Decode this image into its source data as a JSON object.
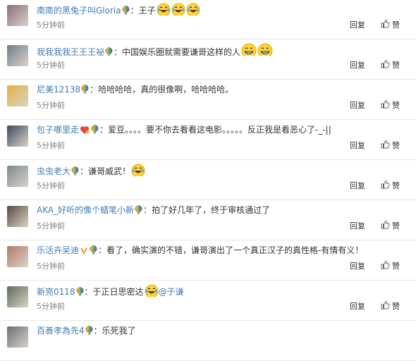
{
  "comments": [
    {
      "user": "南南的黑兔子叫Gloria",
      "badges": [
        "rainbow"
      ],
      "prefix": "",
      "text": "：王子",
      "emojis": [
        "laugh-cry",
        "laugh-cry",
        "laugh-cry"
      ],
      "mention": "",
      "time": "5分钟前",
      "reply": "回复",
      "like": "赞",
      "avatar_color": "#8a6d7a"
    },
    {
      "user": "我我我我王王王祕",
      "badges": [
        "rainbow"
      ],
      "prefix": "",
      "text": "：中国娱乐圈就需要谦哥这样的人",
      "emojis": [
        "grin",
        "grin"
      ],
      "mention": "",
      "time": "5分钟前",
      "reply": "回复",
      "like": "赞",
      "avatar_color": "#6f7d8a"
    },
    {
      "user": "尼美12138",
      "badges": [
        "rainbow"
      ],
      "prefix": "",
      "text": "：哈哈哈哈，真的很像啊，哈哈哈哈。",
      "emojis": [],
      "mention": "",
      "time": "5分钟前",
      "reply": "回复",
      "like": "赞",
      "avatar_color": "#e3b23c"
    },
    {
      "user": "包子哪里走",
      "badges": [
        "heart",
        "rainbow"
      ],
      "prefix": "",
      "text": "：爱豆。。。。要不你去看看这电影。。。。。反正我是看恶心了-_-||",
      "emojis": [],
      "mention": "",
      "time": "5分钟前",
      "reply": "回复",
      "like": "赞",
      "avatar_color": "#3b4a5c"
    },
    {
      "user": "虫虫老大",
      "badges": [
        "rainbow"
      ],
      "prefix": "",
      "text": "：谦哥威武！",
      "emojis": [
        "laugh-cry"
      ],
      "mention": "",
      "time": "5分钟前",
      "reply": "回复",
      "like": "赞",
      "avatar_color": "#7c8a8f"
    },
    {
      "user": "AKA_好听的像个蜡笔小新",
      "badges": [
        "rainbow"
      ],
      "prefix": "",
      "text": "：拍了好几年了，终于审核通过了",
      "emojis": [],
      "mention": "",
      "time": "5分钟前",
      "reply": "回复",
      "like": "赞",
      "avatar_color": "#5a4a3e"
    },
    {
      "user": "乐活卉吴迪",
      "badges": [
        "vip",
        "rainbow"
      ],
      "prefix": "",
      "text": "：看了，确实演的不错，谦哥演出了一个真正汉子的真性格-有情有义！",
      "emojis": [],
      "mention": "",
      "time": "5分钟前",
      "reply": "回复",
      "like": "赞",
      "avatar_color": "#b47b6a"
    },
    {
      "user": "新亮0118",
      "badges": [
        "rainbow"
      ],
      "prefix": "",
      "text": "：于正日思密达",
      "emojis": [
        "laugh-cry"
      ],
      "mention": "@于谦",
      "time": "5分钟前",
      "reply": "回复",
      "like": "赞",
      "avatar_color": "#5d6b55"
    },
    {
      "user": "百善孝為先4",
      "badges": [
        "rainbow"
      ],
      "prefix": "",
      "text": "：乐死我了",
      "emojis": [],
      "mention": "",
      "time": "",
      "reply": "",
      "like": "",
      "avatar_color": "#6d6d75"
    }
  ],
  "colors": {
    "username": "#3f7cb6",
    "divider": "#e6e6e6",
    "time": "#808080"
  },
  "icons": {
    "like": "thumbs-up-icon",
    "badge": "rainbow-balloon-icon"
  }
}
